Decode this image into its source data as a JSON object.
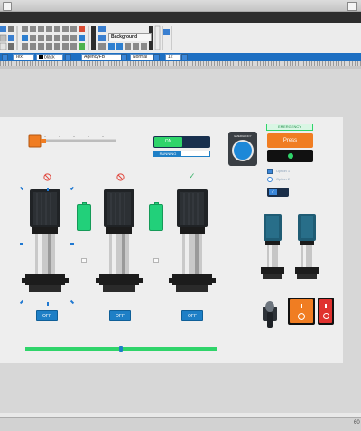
{
  "toolbar": {
    "text_label": "Text",
    "color_value": "black",
    "font_value": "AgencyFB",
    "style_value": "Normal",
    "size_value": "12",
    "background_label": "Background"
  },
  "canvas": {
    "slider": {
      "value": 0.0,
      "tick_labels": [
        "",
        "",
        "",
        "",
        "",
        ""
      ]
    },
    "toggle": {
      "on_label": "ON"
    },
    "running_label": "RUNNING",
    "emergency_label": "EMERGENCY",
    "rounded_label": "EMERGENCY",
    "press_label": "Press",
    "option_labels": [
      "Option 1",
      "Option 2"
    ],
    "pumps": [
      {
        "status": "prohibited",
        "button_label": "OFF"
      },
      {
        "status": "prohibited",
        "button_label": "OFF"
      },
      {
        "status": "ok",
        "button_label": "OFF"
      }
    ],
    "progress": 0.5
  },
  "status": {
    "right_text": "60"
  },
  "colors": {
    "accent_blue": "#1e7fc6",
    "green": "#22d07a",
    "orange": "#f07d22",
    "red": "#e0322f",
    "prohibited_red": "#e0443a",
    "ok_green": "#3cb36b"
  },
  "icons": {
    "prohibited": "prohibited-icon",
    "ok": "check-icon"
  }
}
